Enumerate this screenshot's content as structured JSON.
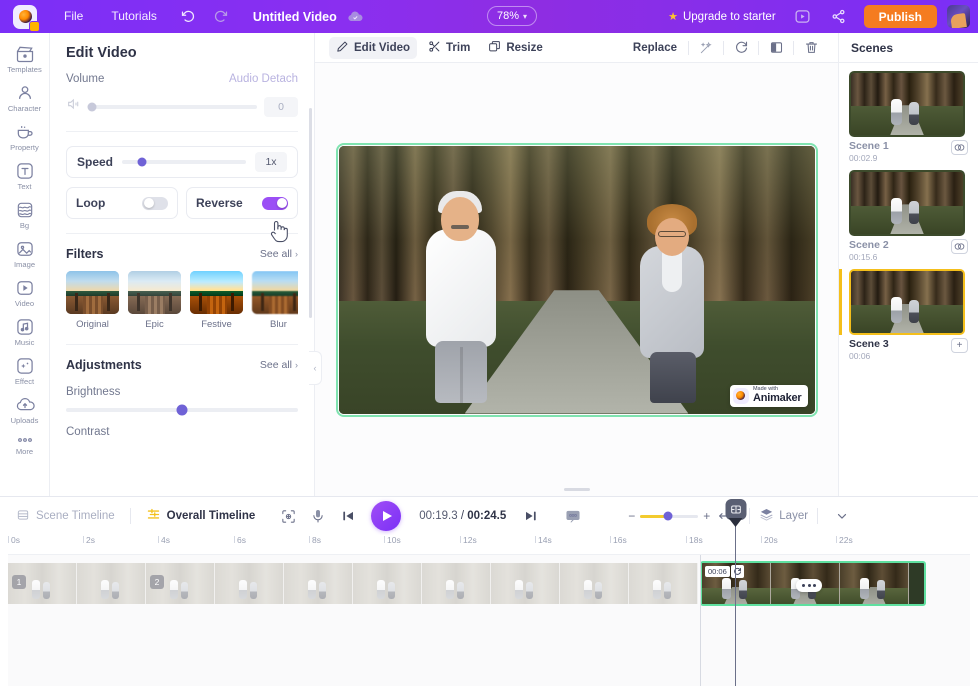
{
  "topbar": {
    "logo_name": "animaker-logo",
    "menus": [
      {
        "label": "File",
        "name": "menu-file"
      },
      {
        "label": "Tutorials",
        "name": "menu-tutorials"
      }
    ],
    "undo_icon": "undo-icon",
    "redo_icon": "redo-icon",
    "doc_title": "Untitled Video",
    "cloud_icon": "cloud-saved-icon",
    "zoom_level": "78%",
    "zoom_caret": "▾",
    "upgrade_label": "Upgrade to starter",
    "upgrade_star": "★",
    "preview_icon": "preview-play-icon",
    "share_icon": "share-icon",
    "publish_label": "Publish",
    "avatar_name": "user-avatar"
  },
  "rail": {
    "items": [
      {
        "label": "Templates",
        "icon": "templates-icon"
      },
      {
        "label": "Character",
        "icon": "character-icon"
      },
      {
        "label": "Property",
        "icon": "property-icon"
      },
      {
        "label": "Text",
        "icon": "text-icon"
      },
      {
        "label": "Bg",
        "icon": "background-icon"
      },
      {
        "label": "Image",
        "icon": "image-icon"
      },
      {
        "label": "Video",
        "icon": "video-icon"
      },
      {
        "label": "Music",
        "icon": "music-icon"
      },
      {
        "label": "Effect",
        "icon": "effect-icon"
      },
      {
        "label": "Uploads",
        "icon": "uploads-icon"
      },
      {
        "label": "More",
        "icon": "more-icon"
      }
    ]
  },
  "panel": {
    "title": "Edit Video",
    "volume_label": "Volume",
    "audio_detach_label": "Audio Detach",
    "volume_value": "0",
    "volume_icon": "speaker-muted-icon",
    "speed_label": "Speed",
    "speed_value": "1x",
    "loop_label": "Loop",
    "loop_on": false,
    "reverse_label": "Reverse",
    "reverse_on": true,
    "filters_label": "Filters",
    "filters_see_all": "See all",
    "filters": [
      {
        "name": "Original"
      },
      {
        "name": "Epic"
      },
      {
        "name": "Festive"
      },
      {
        "name": "Blur"
      }
    ],
    "adjustments_label": "Adjustments",
    "adjustments_see_all": "See all",
    "brightness_label": "Brightness",
    "contrast_label": "Contrast",
    "collapse_icon": "chevron-left-icon"
  },
  "canvas_toolbar": {
    "left": [
      {
        "label": "Edit Video",
        "icon": "pencil-icon",
        "selected": true
      },
      {
        "label": "Trim",
        "icon": "scissors-icon",
        "selected": false
      },
      {
        "label": "Resize",
        "icon": "resize-icon",
        "selected": false
      }
    ],
    "replace_label": "Replace",
    "right_icons": [
      {
        "name": "magic-wand-icon"
      },
      {
        "name": "rotate-icon"
      },
      {
        "name": "flip-icon"
      },
      {
        "name": "trash-icon"
      }
    ]
  },
  "stage": {
    "watermark_made": "Made with",
    "watermark_brand": "Animaker",
    "resize_handle": "stage-resize-handle"
  },
  "scenes": {
    "title": "Scenes",
    "items": [
      {
        "name": "Scene 1",
        "duration": "00:02.9",
        "action_icon": "transition-icon",
        "active": false
      },
      {
        "name": "Scene 2",
        "duration": "00:15.6",
        "action_icon": "transition-icon",
        "active": false
      },
      {
        "name": "Scene 3",
        "duration": "00:06",
        "action_icon": "add-scene-icon",
        "active": true
      }
    ]
  },
  "timeline": {
    "scene_timeline_label": "Scene Timeline",
    "scene_timeline_icon": "scene-timeline-icon",
    "overall_timeline_label": "Overall Timeline",
    "overall_timeline_icon": "overall-timeline-icon",
    "focus_icon": "focus-icon",
    "mic_icon": "microphone-icon",
    "prev_icon": "skip-previous-icon",
    "play_icon": "play-icon",
    "current_time": "00:19.3",
    "time_separator": " / ",
    "total_time": "00:24.5",
    "next_icon": "skip-next-icon",
    "caption_icon": "caption-icon",
    "zoom_minus": "−",
    "zoom_plus": "+",
    "fit_icon": "fit-width-icon",
    "layer_label": "Layer",
    "layer_icon": "layers-icon",
    "collapse_icon": "chevron-down-icon",
    "ruler_ticks": [
      "0s",
      "2s",
      "4s",
      "6s",
      "8s",
      "10s",
      "12s",
      "14s",
      "16s",
      "18s",
      "20s",
      "22s"
    ],
    "clip_numbers": [
      "1",
      "2"
    ],
    "selected_clip_badge": "00:06",
    "selected_clip_loop_icon": "loop-icon",
    "selected_clip_menu_icon": "more-options-icon",
    "playhead_icon": "playhead-split-icon"
  },
  "colors": {
    "brand_purple": "#7b2ff7",
    "publish_orange": "#f57c20",
    "toggle_on": "#9b4ff5",
    "scene_active": "#f4bf1b",
    "clip_selected": "#5fe0a0",
    "zoom_track": "#f3cb2e"
  }
}
